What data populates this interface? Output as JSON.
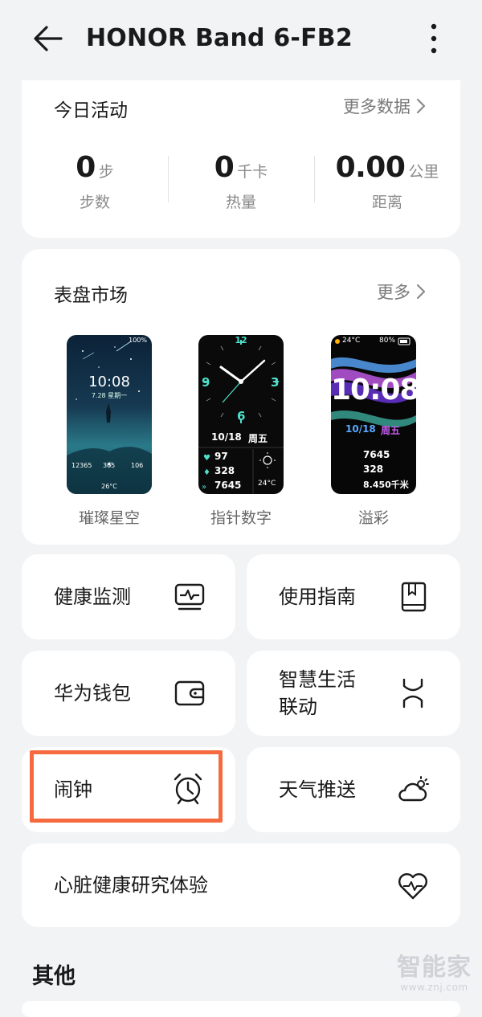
{
  "header": {
    "title": "HONOR Band 6-FB2"
  },
  "activity": {
    "title": "今日活动",
    "more_label": "更多数据",
    "stats": [
      {
        "value": "0",
        "unit": "步",
        "label": "步数"
      },
      {
        "value": "0",
        "unit": "千卡",
        "label": "热量"
      },
      {
        "value": "0.00",
        "unit": "公里",
        "label": "距离"
      }
    ]
  },
  "faces": {
    "title": "表盘市场",
    "more_label": "更多",
    "items": [
      {
        "name": "璀璨星空",
        "battery": "100%",
        "time": "10:08",
        "date": "7.28 星期一",
        "steps": "12365",
        "calories": "365",
        "heart": "106",
        "temp": "26°C"
      },
      {
        "name": "指针数字",
        "date": "10/18",
        "weekday": "周五",
        "heart": "97",
        "calories": "328",
        "steps": "7645",
        "temp": "24°C",
        "dial_numbers": [
          "12",
          "3",
          "6",
          "9"
        ]
      },
      {
        "name": "溢彩",
        "temp": "24°C",
        "battery": "80%",
        "time": "10:08",
        "date": "10/18",
        "weekday": "周五",
        "steps": "7645",
        "calories": "328",
        "distance": "8.450千米"
      }
    ]
  },
  "tiles": {
    "health": "健康监测",
    "guide": "使用指南",
    "wallet": "华为钱包",
    "smart_line1": "智慧生活",
    "smart_line2": "联动",
    "alarm": "闹钟",
    "weather": "天气推送",
    "heart_study": "心脏健康研究体验"
  },
  "section_other": "其他",
  "watermark": {
    "text": "智能家",
    "url": "www.znj.com"
  },
  "colors": {
    "highlight": "#f56b3f",
    "page_bg": "#f1f3f5",
    "card_bg": "#ffffff",
    "accent_cyan": "#4fe0cc",
    "accent_blue": "#5aa8ff",
    "accent_purple": "#c85cf0"
  },
  "icons": [
    "back-arrow-icon",
    "more-vertical-icon",
    "chevron-right-icon",
    "health-monitor-icon",
    "book-icon",
    "wallet-icon",
    "smart-link-icon",
    "alarm-clock-icon",
    "weather-icon",
    "heart-pulse-icon"
  ]
}
